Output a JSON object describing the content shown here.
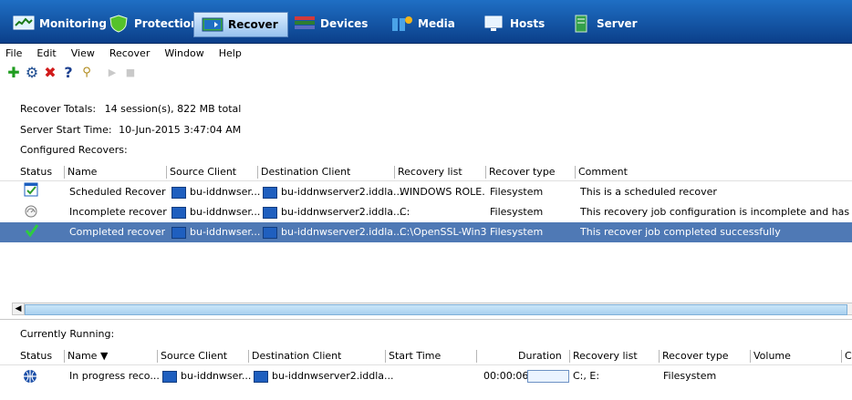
{
  "nav": {
    "tabs": [
      {
        "label": "Monitoring",
        "icon": "monitoring-icon",
        "active": false
      },
      {
        "label": "Protection",
        "icon": "protection-shield-icon",
        "active": false
      },
      {
        "label": "Recover",
        "icon": "recover-icon",
        "active": true
      },
      {
        "label": "Devices",
        "icon": "devices-icon",
        "active": false
      },
      {
        "label": "Media",
        "icon": "media-icon",
        "active": false
      },
      {
        "label": "Hosts",
        "icon": "hosts-icon",
        "active": false
      },
      {
        "label": "Server",
        "icon": "server-icon",
        "active": false
      }
    ]
  },
  "menu": {
    "items": [
      "File",
      "Edit",
      "View",
      "Recover",
      "Window",
      "Help"
    ]
  },
  "toolbar": {
    "buttons": [
      {
        "icon": "add-icon",
        "color": "#1f9c1f",
        "glyph": "✚"
      },
      {
        "icon": "properties-icon",
        "color": "#1b4a8f",
        "glyph": "⚙"
      },
      {
        "icon": "delete-icon",
        "color": "#d11a1a",
        "glyph": "✖"
      },
      {
        "icon": "help-icon",
        "color": "#1b3f8f",
        "glyph": "?"
      },
      {
        "icon": "search-icon",
        "color": "#b08a1b",
        "glyph": "🔍"
      },
      {
        "icon": "play-icon",
        "color": "#c9c9c9",
        "glyph": "▶"
      },
      {
        "icon": "stop-icon",
        "color": "#c9c9c9",
        "glyph": "■"
      }
    ]
  },
  "summary": {
    "recover_totals_label": "Recover Totals:",
    "recover_totals_value": "14 session(s), 822 MB total",
    "server_start_label": "Server Start Time:",
    "server_start_value": "10-Jun-2015 3:47:04 AM",
    "configured_label": "Configured Recovers:"
  },
  "configured": {
    "columns": [
      "Status",
      "Name",
      "Source Client",
      "Destination Client",
      "Recovery list",
      "Recover type",
      "Comment"
    ],
    "rows": [
      {
        "status_icon": "scheduled-check-icon",
        "name": "Scheduled Recover",
        "source": "bu-iddnwser...",
        "destination": "bu-iddnwserver2.iddla...",
        "recovery_list": "WINDOWS ROLE...",
        "type": "Filesystem",
        "comment": "This is a scheduled recover",
        "selected": false
      },
      {
        "status_icon": "incomplete-gauge-icon",
        "name": "Incomplete recover",
        "source": "bu-iddnwser...",
        "destination": "bu-iddnwserver2.iddla...",
        "recovery_list": "C:",
        "type": "Filesystem",
        "comment": "This recovery job configuration is incomplete and has not run",
        "selected": false
      },
      {
        "status_icon": "completed-check-icon",
        "name": "Completed recover",
        "source": "bu-iddnwser...",
        "destination": "bu-iddnwserver2.iddla...",
        "recovery_list": "C:\\OpenSSL-Win32",
        "type": "Filesystem",
        "comment": "This recover job completed successfully",
        "selected": true
      }
    ]
  },
  "running": {
    "label": "Currently Running:",
    "columns": [
      "Status",
      "Name ▼",
      "Source Client",
      "Destination Client",
      "Start Time",
      "Duration",
      "Recovery list",
      "Recover type",
      "Volume",
      "C"
    ],
    "rows": [
      {
        "status_icon": "in-progress-globe-icon",
        "name": "In progress reco...",
        "source": "bu-iddnwser...",
        "destination": "bu-iddnwserver2.iddla...",
        "start": "",
        "duration": "00:00:06",
        "progress": 0.0,
        "recovery_list": "C:, E:",
        "type": "Filesystem",
        "volume": ""
      }
    ]
  }
}
